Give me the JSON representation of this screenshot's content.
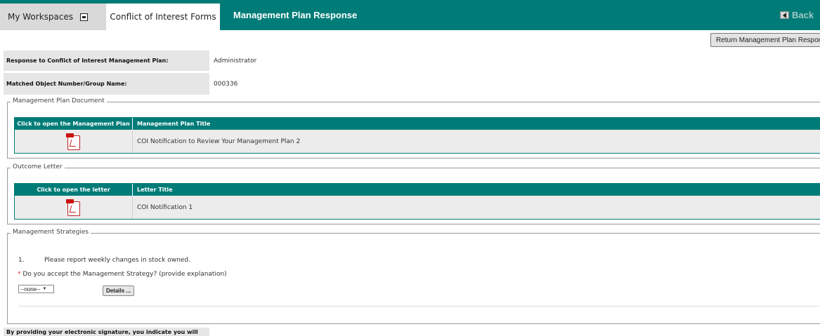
{
  "nav": {
    "workspaces_label": "My Workspaces",
    "coi_tab_label": "Conflict of Interest Forms",
    "page_title": "Management Plan Response",
    "back_label": "Back",
    "accent_color": "#007c78"
  },
  "actions": {
    "return_label": "Return Management Plan Response"
  },
  "info": {
    "response_label": "Response to Conflict of Interest Management Plan:",
    "response_value": "Administrator",
    "matched_label": "Matched Object Number/Group Name:",
    "matched_value": "000336"
  },
  "plan_document": {
    "legend": "Management Plan Document",
    "col_open": "Click to open the Management Plan",
    "col_title": "Management Plan Title",
    "rows": [
      {
        "icon": "pdf-icon",
        "title": "COI Notification to Review Your Management Plan 2"
      }
    ]
  },
  "outcome_letter": {
    "legend": "Outcome Letter",
    "col_open": "Click to open the letter",
    "col_title": "Letter Title",
    "rows": [
      {
        "icon": "pdf-icon",
        "title": "COI Notification 1"
      }
    ]
  },
  "strategies": {
    "legend": "Management Strategies",
    "items": [
      {
        "number": "1.",
        "text": "Please report weekly changes in stock owned.",
        "question": "Do you accept the Management Strategy? (provide explanation)",
        "required_mark": "*",
        "select_value": "--none--",
        "details_label": "Details ..."
      }
    ]
  },
  "signature": {
    "banner_text": "By providing your electronic signature, you indicate you will"
  }
}
